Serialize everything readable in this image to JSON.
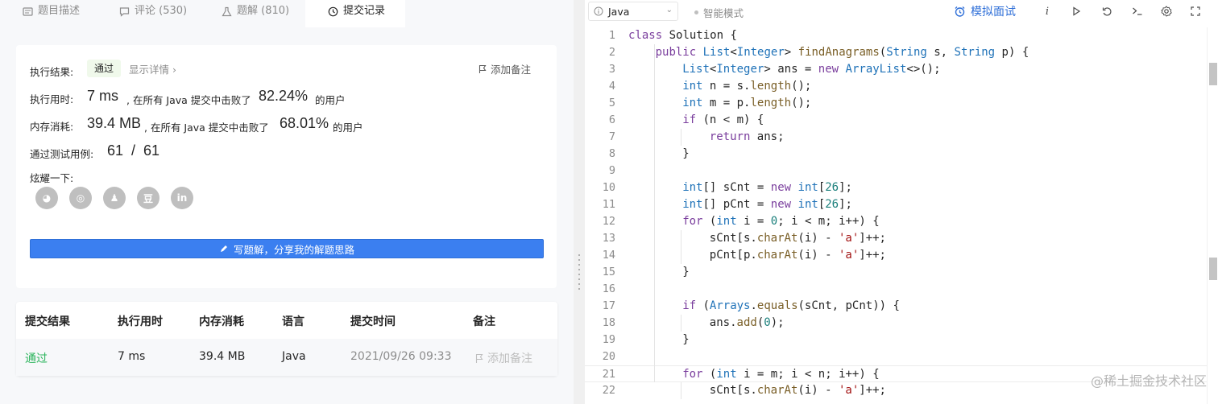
{
  "tabs": [
    {
      "label": "题目描述",
      "icon": "description-icon"
    },
    {
      "label": "评论 (530)",
      "icon": "comment-icon"
    },
    {
      "label": "题解 (810)",
      "icon": "flask-icon"
    },
    {
      "label": "提交记录",
      "icon": "history-icon"
    }
  ],
  "result": {
    "result_label": "执行结果:",
    "status": "通过",
    "details_link": "显示详情 ›",
    "add_note": "添加备注",
    "runtime_label": "执行用时:",
    "runtime_value": "7 ms",
    "runtime_text": ", 在所有 Java 提交中击败了",
    "runtime_percent": "82.24%",
    "runtime_suffix": "的用户",
    "memory_label": "内存消耗:",
    "memory_value": "39.4 MB",
    "memory_text": ", 在所有 Java 提交中击败了",
    "memory_percent": "68.01%",
    "memory_suffix": "的用户",
    "tests_label": "通过测试用例:",
    "tests_value": "61  /  61",
    "share_label": "炫耀一下:",
    "share_icons": [
      "wechat-icon",
      "weibo-icon",
      "qq-icon",
      "douban-icon",
      "linkedin-icon"
    ],
    "share_glyphs": [
      "◕",
      "◎",
      "♟",
      "豆",
      "in"
    ],
    "write_button": "写题解，分享我的解题思路"
  },
  "table": {
    "headers": [
      "提交结果",
      "执行用时",
      "内存消耗",
      "语言",
      "提交时间",
      "备注"
    ],
    "row": {
      "result": "通过",
      "runtime": "7 ms",
      "memory": "39.4 MB",
      "language": "Java",
      "time": "2021/09/26 09:33",
      "note": "添加备注"
    }
  },
  "editor_toolbar": {
    "language": "Java",
    "smart_mode": "智能模式",
    "mock_interview": "模拟面试",
    "icons": [
      "info-icon",
      "run-icon",
      "reset-icon",
      "console-icon",
      "settings-icon",
      "fullscreen-icon"
    ]
  },
  "code_lines": [
    {
      "n": "1",
      "indent": 0,
      "html": "<span class='kw'>class</span> Solution {"
    },
    {
      "n": "2",
      "indent": 1,
      "html": "<span class='kw'>public</span> <span class='ty'>List</span>&lt;<span class='ty'>Integer</span>&gt; <span class='fn'>findAnagrams</span>(<span class='ty'>String</span> s, <span class='ty'>String</span> p) {"
    },
    {
      "n": "3",
      "indent": 2,
      "html": "<span class='ty'>List</span>&lt;<span class='ty'>Integer</span>&gt; ans = <span class='kw'>new</span> <span class='ty'>ArrayList</span>&lt;&gt;();"
    },
    {
      "n": "4",
      "indent": 2,
      "html": "<span class='ty'>int</span> n = s.<span class='fn'>length</span>();"
    },
    {
      "n": "5",
      "indent": 2,
      "html": "<span class='ty'>int</span> m = p.<span class='fn'>length</span>();"
    },
    {
      "n": "6",
      "indent": 2,
      "html": "<span class='kw'>if</span> (n &lt; m) {"
    },
    {
      "n": "7",
      "indent": 3,
      "html": "<span class='kw'>return</span> ans;"
    },
    {
      "n": "8",
      "indent": 2,
      "html": "}"
    },
    {
      "n": "9",
      "indent": 0,
      "html": ""
    },
    {
      "n": "10",
      "indent": 2,
      "html": "<span class='ty'>int</span>[] sCnt = <span class='kw'>new</span> <span class='ty'>int</span>[<span class='num-lit'>26</span>];"
    },
    {
      "n": "11",
      "indent": 2,
      "html": "<span class='ty'>int</span>[] pCnt = <span class='kw'>new</span> <span class='ty'>int</span>[<span class='num-lit'>26</span>];"
    },
    {
      "n": "12",
      "indent": 2,
      "html": "<span class='kw'>for</span> (<span class='ty'>int</span> i = <span class='num-lit'>0</span>; i &lt; m; i++) {"
    },
    {
      "n": "13",
      "indent": 3,
      "html": "sCnt[s.<span class='fn'>charAt</span>(i) - <span class='str'>'a'</span>]++;"
    },
    {
      "n": "14",
      "indent": 3,
      "html": "pCnt[p.<span class='fn'>charAt</span>(i) - <span class='str'>'a'</span>]++;"
    },
    {
      "n": "15",
      "indent": 2,
      "html": "}"
    },
    {
      "n": "16",
      "indent": 0,
      "html": ""
    },
    {
      "n": "17",
      "indent": 2,
      "html": "<span class='kw'>if</span> (<span class='ty'>Arrays</span>.<span class='fn'>equals</span>(sCnt, pCnt)) {"
    },
    {
      "n": "18",
      "indent": 3,
      "html": "ans.<span class='fn'>add</span>(<span class='num-lit'>0</span>);"
    },
    {
      "n": "19",
      "indent": 2,
      "html": "}"
    },
    {
      "n": "20",
      "indent": 0,
      "html": ""
    },
    {
      "n": "21",
      "indent": 2,
      "html": "<span class='kw'>for</span> (<span class='ty'>int</span> i = m; i &lt; n; i++) {",
      "current": true
    },
    {
      "n": "22",
      "indent": 3,
      "html": "sCnt[s.<span class='fn'>charAt</span>(i) - <span class='str'>'a'</span>]++;"
    }
  ],
  "watermark": "@稀土掘金技术社区"
}
